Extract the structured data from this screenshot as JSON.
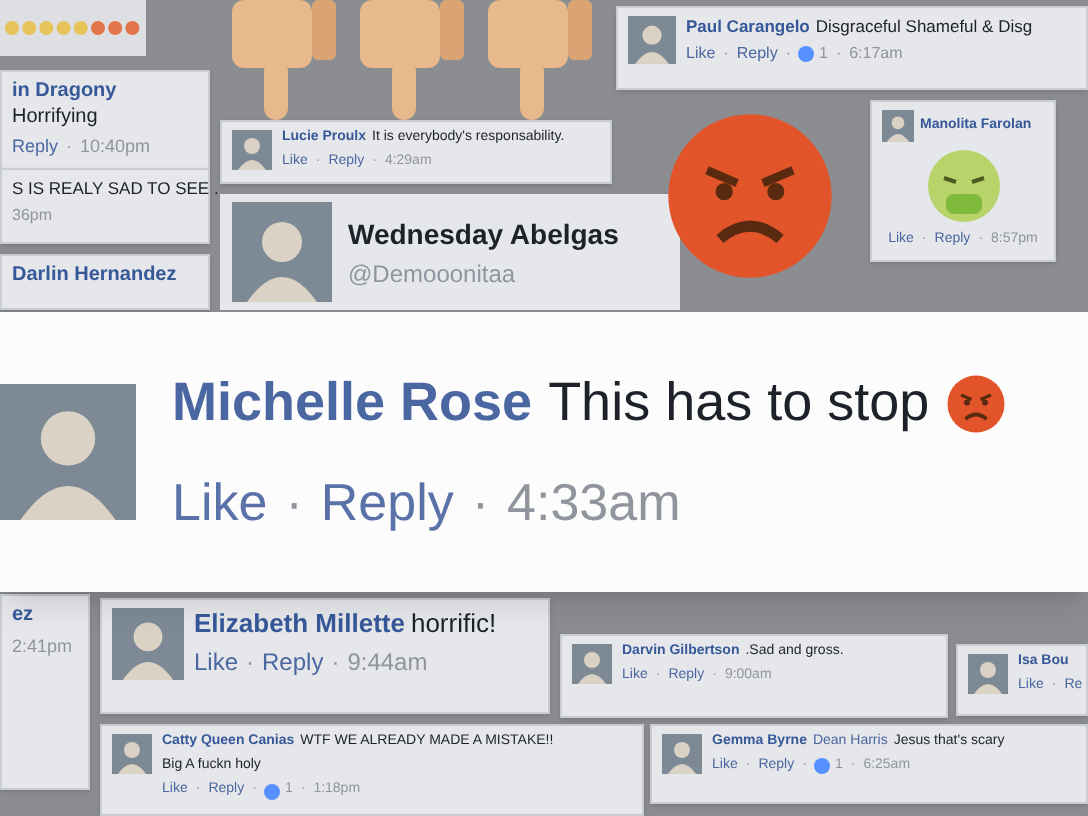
{
  "cards": [
    {
      "kind": "comment",
      "name": "in Dragony",
      "text": "Horrifying",
      "meta": [
        {
          "kind": "link",
          "text": "Reply"
        },
        {
          "kind": "sep",
          "text": "·"
        },
        {
          "kind": "time",
          "text": "10:40pm"
        }
      ]
    },
    {
      "kind": "comment",
      "text": "S IS REALY SAD TO SEE .",
      "meta": [
        {
          "kind": "time",
          "text": "36pm"
        }
      ]
    },
    {
      "kind": "comment",
      "name": "Darlin Hernandez"
    },
    {
      "kind": "comment",
      "name": "Lucie Proulx",
      "text": "It is everybody's responsability.",
      "avatar": true,
      "meta": [
        {
          "kind": "link",
          "text": "Like"
        },
        {
          "kind": "sep",
          "text": "·"
        },
        {
          "kind": "link",
          "text": "Reply"
        },
        {
          "kind": "sep",
          "text": "·"
        },
        {
          "kind": "time",
          "text": "4:29am"
        }
      ]
    },
    {
      "kind": "comment",
      "name": "Paul Carangelo",
      "text": "Disgraceful Shameful & Disg",
      "avatar": true,
      "meta": [
        {
          "kind": "link",
          "text": "Like"
        },
        {
          "kind": "sep",
          "text": "·"
        },
        {
          "kind": "link",
          "text": "Reply"
        },
        {
          "kind": "sep",
          "text": "·"
        },
        {
          "kind": "likes",
          "text": "1"
        },
        {
          "kind": "sep",
          "text": "·"
        },
        {
          "kind": "time",
          "text": "6:17am"
        }
      ]
    },
    {
      "kind": "sticker",
      "name": "Manolita Farolan",
      "avatar": true,
      "meta": [
        {
          "kind": "link",
          "text": "Like"
        },
        {
          "kind": "sep",
          "text": "·"
        },
        {
          "kind": "link",
          "text": "Reply"
        },
        {
          "kind": "sep",
          "text": "·"
        },
        {
          "kind": "time",
          "text": "8:57pm"
        }
      ]
    },
    {
      "kind": "comment",
      "name": "ez",
      "meta": [
        {
          "kind": "time",
          "text": "2:41pm"
        }
      ]
    },
    {
      "kind": "comment",
      "name": "Elizabeth Millette",
      "text": "horrific!",
      "avatar": true,
      "meta": [
        {
          "kind": "link",
          "text": "Like"
        },
        {
          "kind": "sep",
          "text": "·"
        },
        {
          "kind": "link",
          "text": "Reply"
        },
        {
          "kind": "sep",
          "text": "·"
        },
        {
          "kind": "time",
          "text": "9:44am"
        }
      ]
    },
    {
      "kind": "comment",
      "name": "Catty Queen Canias",
      "text": "WTF WE ALREADY MADE A MISTAKE!!",
      "second_line": "Big A fuckn holy",
      "avatar": true,
      "meta": [
        {
          "kind": "link",
          "text": "Like"
        },
        {
          "kind": "sep",
          "text": "·"
        },
        {
          "kind": "link",
          "text": "Reply"
        },
        {
          "kind": "sep",
          "text": "·"
        },
        {
          "kind": "likes",
          "text": "1"
        },
        {
          "kind": "sep",
          "text": "·"
        },
        {
          "kind": "time",
          "text": "1:18pm"
        }
      ]
    },
    {
      "kind": "comment",
      "name": "Darvin Gilbertson",
      "text": ".Sad and gross.",
      "avatar": true,
      "meta": [
        {
          "kind": "link",
          "text": "Like"
        },
        {
          "kind": "sep",
          "text": "·"
        },
        {
          "kind": "link",
          "text": "Reply"
        },
        {
          "kind": "sep",
          "text": "·"
        },
        {
          "kind": "time",
          "text": "9:00am"
        }
      ]
    },
    {
      "kind": "comment",
      "name": "Isa Bou",
      "avatar": true,
      "meta": [
        {
          "kind": "link",
          "text": "Like"
        },
        {
          "kind": "sep",
          "text": "·"
        },
        {
          "kind": "link",
          "text": "Re"
        }
      ]
    },
    {
      "kind": "comment",
      "name": "Gemma Byrne",
      "tag": "Dean Harris",
      "text": "Jesus that's scary",
      "avatar": true,
      "meta": [
        {
          "kind": "link",
          "text": "Like"
        },
        {
          "kind": "sep",
          "text": "·"
        },
        {
          "kind": "link",
          "text": "Reply"
        },
        {
          "kind": "sep",
          "text": "·"
        },
        {
          "kind": "likes",
          "text": "1"
        },
        {
          "kind": "sep",
          "text": "·"
        },
        {
          "kind": "time",
          "text": "6:25am"
        }
      ]
    }
  ],
  "profile": {
    "name": "Wednesday Abelgas",
    "handle": "@Demooonitaa"
  },
  "featured": {
    "name": "Michelle Rose",
    "text": "This has to stop",
    "meta": [
      {
        "kind": "link",
        "text": "Like"
      },
      {
        "kind": "sep",
        "text": "·"
      },
      {
        "kind": "link",
        "text": "Reply"
      },
      {
        "kind": "sep",
        "text": "·"
      },
      {
        "kind": "time",
        "text": "4:33am"
      }
    ]
  }
}
